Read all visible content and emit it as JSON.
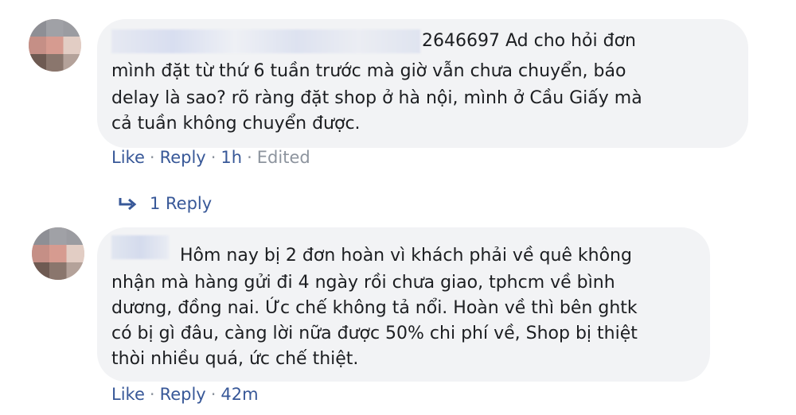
{
  "comments": [
    {
      "name_visible_suffix": "2646697",
      "lines": [
        " Ad cho hỏi đơn",
        "mình đặt từ thứ 6 tuần trước mà giờ vẫn chưa chuyển, báo",
        "delay là sao? rõ ràng đặt shop ở hà nội, mình ở Cầu Giấy mà",
        "cả tuần không chuyển được."
      ],
      "actions": {
        "like": "Like",
        "reply": "Reply",
        "time": "1h",
        "edited": "Edited"
      },
      "replies_label": "1 Reply"
    },
    {
      "lines": [
        "Hôm nay bị 2 đơn hoàn vì khách phải về quê không",
        "nhận mà hàng gửi đi 4 ngày rồi chưa giao, tphcm về bình",
        "dương, đồng nai. Ức chế không tả nổi. Hoàn về thì bên ghtk",
        "có bị gì đâu, càng lời nữa được 50% chi phí về, Shop bị thiệt",
        "thòi nhiều quá, ức chế thiệt."
      ],
      "actions": {
        "like": "Like",
        "reply": "Reply",
        "time": "42m"
      }
    }
  ],
  "icons": {
    "reply_arrow": "reply-arrow-icon"
  },
  "colors": {
    "link": "#385898",
    "meta": "#8d949e",
    "bubble": "#f2f3f5"
  }
}
